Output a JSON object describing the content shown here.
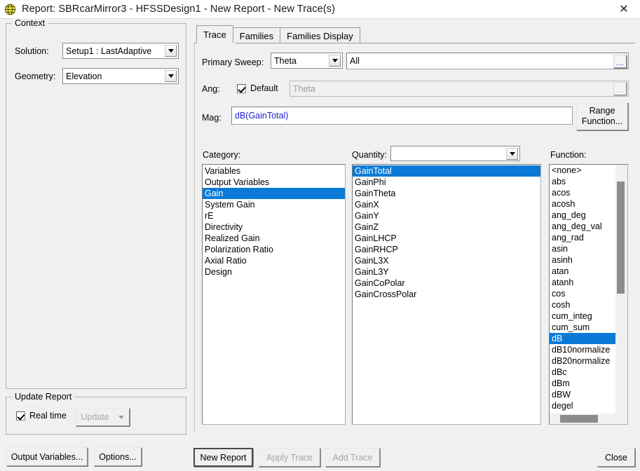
{
  "window": {
    "title": "Report: SBRcarMirror3 - HFSSDesign1 - New Report - New Trace(s)",
    "icon": "hfss-globe-icon",
    "close_label": "✕"
  },
  "context": {
    "group_label": "Context",
    "solution_label": "Solution:",
    "solution_value": "Setup1 : LastAdaptive",
    "geometry_label": "Geometry:",
    "geometry_value": "Elevation"
  },
  "update_report": {
    "group_label": "Update Report",
    "realtime_label": "Real time",
    "realtime_checked": true,
    "update_label": "Update",
    "update_enabled": false
  },
  "footer_left": {
    "output_variables_label": "Output Variables...",
    "options_label": "Options..."
  },
  "tabs": [
    {
      "label": "Trace",
      "active": true
    },
    {
      "label": "Families",
      "active": false
    },
    {
      "label": "Families Display",
      "active": false
    }
  ],
  "trace": {
    "primary_sweep_label": "Primary Sweep:",
    "primary_sweep_value": "Theta",
    "sweep_range_value": "All",
    "sweep_range_browse": "...",
    "ang_label": "Ang:",
    "ang_default_label": "Default",
    "ang_default_checked": true,
    "ang_value": "Theta",
    "ang_browse": "...",
    "mag_label": "Mag:",
    "mag_value": "dB(GainTotal)",
    "range_function_label_line1": "Range",
    "range_function_label_line2": "Function..."
  },
  "category": {
    "label": "Category:",
    "items": [
      "Variables",
      "Output Variables",
      "Gain",
      "System Gain",
      "rE",
      "Directivity",
      "Realized Gain",
      "Polarization Ratio",
      "Axial Ratio",
      "Design"
    ],
    "selected_index": 2
  },
  "quantity": {
    "label": "Quantity:",
    "filter_value": "",
    "items": [
      "GainTotal",
      "GainPhi",
      "GainTheta",
      "GainX",
      "GainY",
      "GainZ",
      "GainLHCP",
      "GainRHCP",
      "GainL3X",
      "GainL3Y",
      "GainCoPolar",
      "GainCrossPolar"
    ],
    "selected_index": 0
  },
  "function": {
    "label": "Function:",
    "items": [
      "<none>",
      "abs",
      "acos",
      "acosh",
      "ang_deg",
      "ang_deg_val",
      "ang_rad",
      "asin",
      "asinh",
      "atan",
      "atanh",
      "cos",
      "cosh",
      "cum_integ",
      "cum_sum",
      "dB",
      "dB10normalize",
      "dB20normalize",
      "dBc",
      "dBm",
      "dBW",
      "degel"
    ],
    "selected_index": 15
  },
  "footer_buttons": [
    {
      "label": "New Report",
      "state": "default"
    },
    {
      "label": "Apply Trace",
      "state": "disabled"
    },
    {
      "label": "Add Trace",
      "state": "disabled"
    },
    {
      "label": "Close",
      "state": "normal"
    }
  ],
  "colors": {
    "selection_blue": "#0a7ad6",
    "expression_blue": "#2020d0",
    "window_bg": "#f0f0f0",
    "title_icon_yellow": "#e8e14a"
  }
}
